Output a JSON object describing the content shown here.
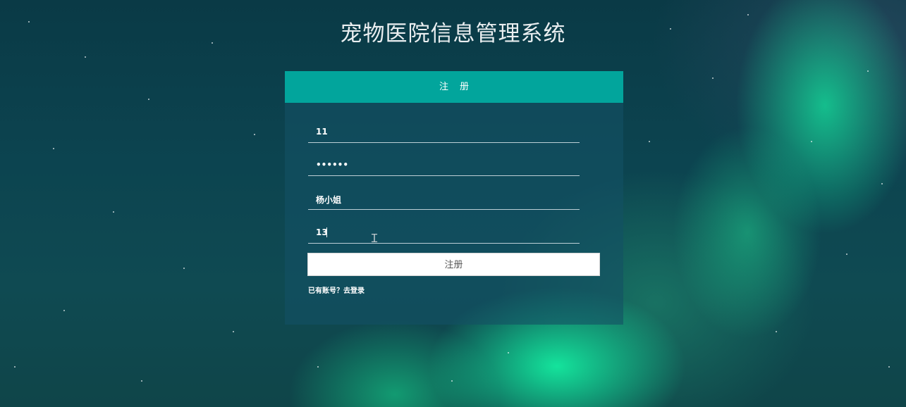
{
  "app": {
    "title": "宠物医院信息管理系统"
  },
  "register": {
    "header_label": "注册",
    "fields": {
      "username_value": "11",
      "password_value": "••••••",
      "name_value": "杨小姐",
      "phone_value": "13"
    },
    "submit_label": "注册",
    "login_link_label": "已有账号？去登录"
  },
  "icons": {
    "text_cursor": "i-beam-cursor-icon"
  },
  "colors": {
    "header_bg": "#02a59c",
    "card_bg": "rgba(20,80,100,0.62)",
    "page_bg": "#0c4450",
    "aurora": "#14eba0"
  }
}
